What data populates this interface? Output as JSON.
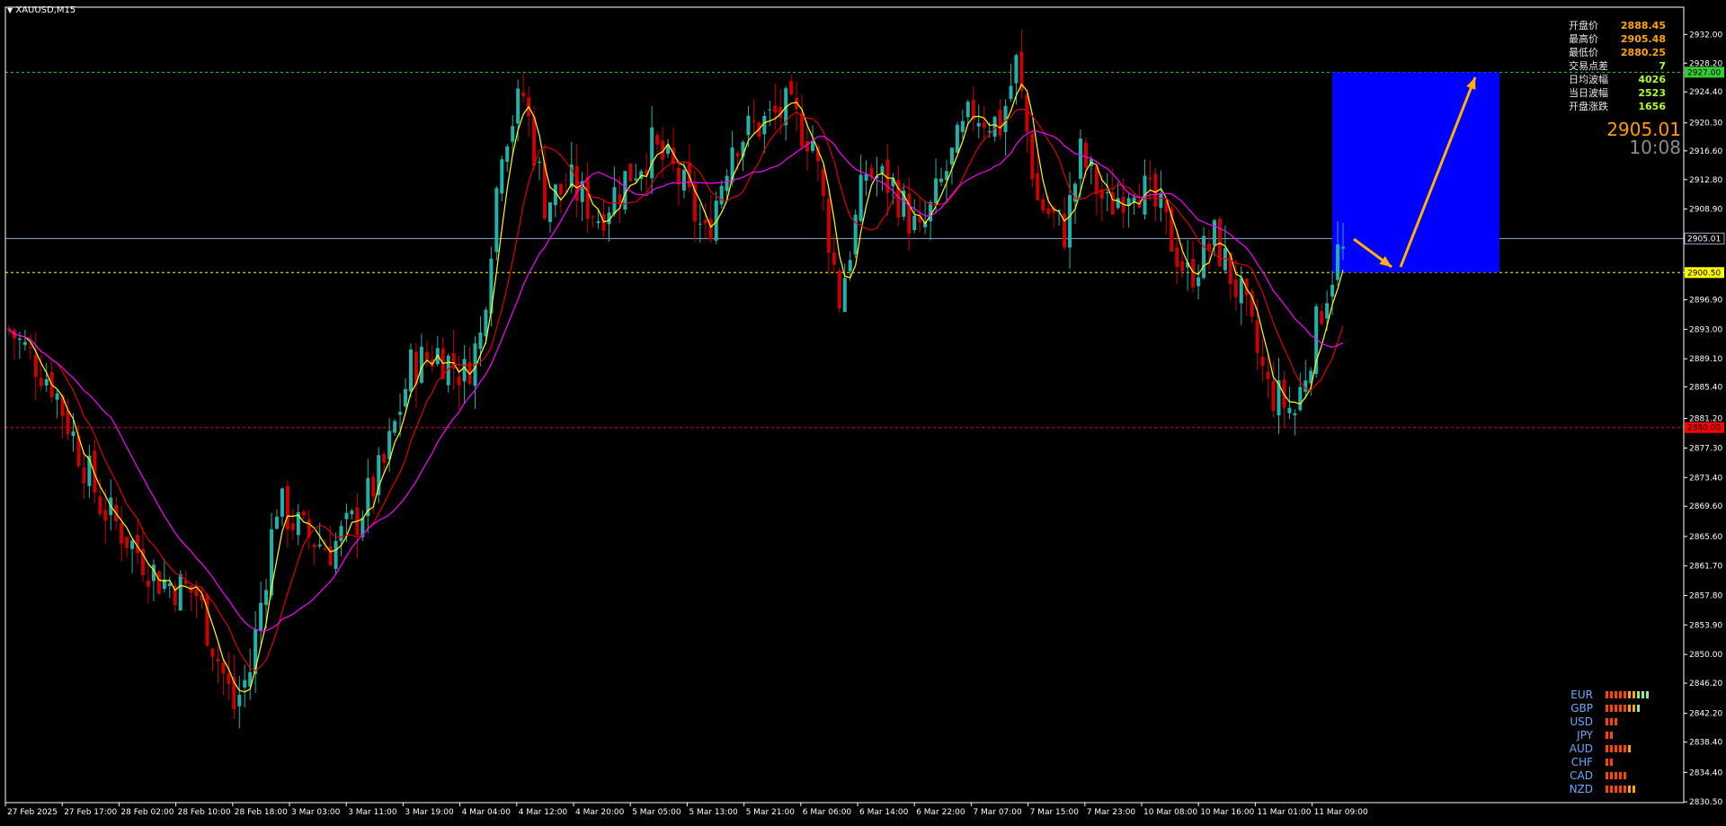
{
  "symbol": "XAUUSD,M15",
  "info_panel": [
    {
      "label": "开盘价",
      "value": "2888.45",
      "color": "#ffa500"
    },
    {
      "label": "最高价",
      "value": "2905.48",
      "color": "#ffa500"
    },
    {
      "label": "最低价",
      "value": "2880.25",
      "color": "#ffa500"
    },
    {
      "label": "交易点差",
      "value": "7",
      "color": "#adff2f"
    },
    {
      "label": "日均波幅",
      "value": "4026",
      "color": "#adff2f"
    },
    {
      "label": "当日波幅",
      "value": "2523",
      "color": "#adff2f"
    },
    {
      "label": "开盘涨跌",
      "value": "1656",
      "color": "#adff2f"
    }
  ],
  "current_price": "2905.01",
  "countdown": "10:08",
  "strength_meter": [
    {
      "name": "EUR",
      "level": 10
    },
    {
      "name": "GBP",
      "level": 8
    },
    {
      "name": "USD",
      "level": 3
    },
    {
      "name": "JPY",
      "level": 2
    },
    {
      "name": "AUD",
      "level": 6
    },
    {
      "name": "CHF",
      "level": 2
    },
    {
      "name": "CAD",
      "level": 5
    },
    {
      "name": "NZD",
      "level": 7
    }
  ],
  "colors": {
    "bull_candle": "#20b2aa",
    "bear_candle": "#cc0000",
    "ma_fast": "#ffff00",
    "ma_mid": "#e00000",
    "ma_slow": "#ff00ff",
    "target_box": "#0000ff",
    "arrow": "#ffb300",
    "strength_on": "#ff4500",
    "strength_hi": "#90ee90"
  },
  "chart_data": {
    "type": "candlestick",
    "ylim": [
      2830.4,
      2935.6
    ],
    "y_ticks": [
      "2932.00",
      "2928.20",
      "2924.40",
      "2920.30",
      "2916.60",
      "2912.80",
      "2908.90",
      "2905.01",
      "2900.50",
      "2896.90",
      "2893.00",
      "2889.10",
      "2885.40",
      "2881.20",
      "2877.30",
      "2873.40",
      "2869.60",
      "2865.60",
      "2861.70",
      "2857.80",
      "2853.90",
      "2850.00",
      "2846.20",
      "2842.20",
      "2838.40",
      "2834.40",
      "2830.50"
    ],
    "x_ticks": [
      "27 Feb 2025",
      "27 Feb 17:00",
      "28 Feb 02:00",
      "28 Feb 10:00",
      "28 Feb 18:00",
      "3 Mar 03:00",
      "3 Mar 11:00",
      "3 Mar 19:00",
      "4 Mar 04:00",
      "4 Mar 12:00",
      "4 Mar 20:00",
      "5 Mar 05:00",
      "5 Mar 13:00",
      "5 Mar 21:00",
      "6 Mar 06:00",
      "6 Mar 14:00",
      "6 Mar 22:00",
      "7 Mar 07:00",
      "7 Mar 15:00",
      "7 Mar 23:00",
      "10 Mar 08:00",
      "10 Mar 16:00",
      "11 Mar 01:00",
      "11 Mar 09:00"
    ],
    "horizontal_levels": [
      {
        "price": 2927.0,
        "label": "2927.00",
        "color": "#33cc33",
        "style": "dashed"
      },
      {
        "price": 2905.01,
        "label": "2905.01",
        "color": "#8fa8c8",
        "style": "solid"
      },
      {
        "price": 2900.5,
        "label": "2900.50",
        "color": "#ffff00",
        "style": "dashed"
      },
      {
        "price": 2880.0,
        "label": "2880.00",
        "color": "#ff0000",
        "style": "dashed"
      }
    ],
    "target_box": {
      "price_top": 2927.0,
      "price_bottom": 2900.5
    },
    "close_path": [
      [
        0,
        2893
      ],
      [
        8,
        2886
      ],
      [
        17,
        2870
      ],
      [
        28,
        2860
      ],
      [
        35,
        2858
      ],
      [
        42,
        2843
      ],
      [
        45,
        2848
      ],
      [
        50,
        2870
      ],
      [
        55,
        2866
      ],
      [
        60,
        2864
      ],
      [
        65,
        2868
      ],
      [
        70,
        2875
      ],
      [
        75,
        2888
      ],
      [
        80,
        2890
      ],
      [
        85,
        2887
      ],
      [
        88,
        2892
      ],
      [
        92,
        2918
      ],
      [
        96,
        2924
      ],
      [
        100,
        2910
      ],
      [
        105,
        2912
      ],
      [
        110,
        2908
      ],
      [
        115,
        2913
      ],
      [
        120,
        2917
      ],
      [
        125,
        2913
      ],
      [
        130,
        2905
      ],
      [
        135,
        2918
      ],
      [
        140,
        2920
      ],
      [
        145,
        2922
      ],
      [
        150,
        2918
      ],
      [
        155,
        2897
      ],
      [
        160,
        2914
      ],
      [
        165,
        2912
      ],
      [
        170,
        2905
      ],
      [
        175,
        2914
      ],
      [
        180,
        2922
      ],
      [
        185,
        2920
      ],
      [
        188,
        2928
      ],
      [
        192,
        2910
      ],
      [
        197,
        2906
      ],
      [
        200,
        2916
      ],
      [
        205,
        2909
      ],
      [
        210,
        2913
      ],
      [
        215,
        2908
      ],
      [
        220,
        2900
      ],
      [
        225,
        2905
      ],
      [
        230,
        2897
      ],
      [
        235,
        2885
      ],
      [
        240,
        2882
      ],
      [
        245,
        2896
      ],
      [
        248,
        2903
      ]
    ]
  }
}
